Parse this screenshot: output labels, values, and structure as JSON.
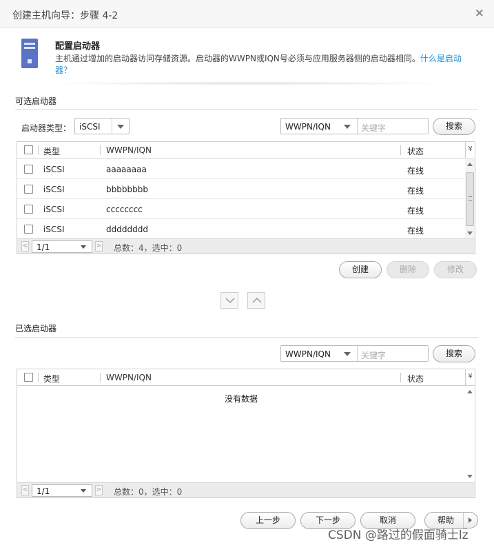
{
  "window": {
    "title": "创建主机向导：步骤 4-2",
    "close_glyph": "×"
  },
  "header": {
    "title": "配置启动器",
    "description": "主机通过增加的启动器访问存储资源。启动器的WWPN或IQN号必须与应用服务器侧的启动器相同。",
    "help_link": "什么是启动器？"
  },
  "available": {
    "section_title": "可选启动器",
    "type_label": "启动器类型：",
    "type_value": "iSCSI",
    "search_field": "WWPN/IQN",
    "keyword_placeholder": "关键字",
    "search_button": "搜索",
    "columns": [
      "类型",
      "WWPN/IQN",
      "状态"
    ],
    "rows": [
      {
        "type": "iSCSI",
        "id": "aaaaaaaa",
        "status": "在线"
      },
      {
        "type": "iSCSI",
        "id": "bbbbbbbb",
        "status": "在线"
      },
      {
        "type": "iSCSI",
        "id": "cccccccc",
        "status": "在线"
      },
      {
        "type": "iSCSI",
        "id": "dddddddd",
        "status": "在线"
      }
    ],
    "page": "1/1",
    "total": "总数：4，选中：0",
    "create_button": "创建",
    "delete_button": "删除",
    "modify_button": "修改"
  },
  "selected": {
    "section_title": "已选启动器",
    "search_field": "WWPN/IQN",
    "keyword_placeholder": "关键字",
    "search_button": "搜索",
    "columns": [
      "类型",
      "WWPN/IQN",
      "状态"
    ],
    "empty_text": "没有数据",
    "page": "1/1",
    "total": "总数：0，选中：0"
  },
  "footer": {
    "prev_button": "上一步",
    "next_button": "下一步",
    "cancel_button": "取消",
    "help_button": "帮助"
  },
  "watermark": "CSDN @路过的假面骑士lz",
  "colors": {
    "accent": "#1d8ed8",
    "server_icon": "#5a73c4"
  }
}
